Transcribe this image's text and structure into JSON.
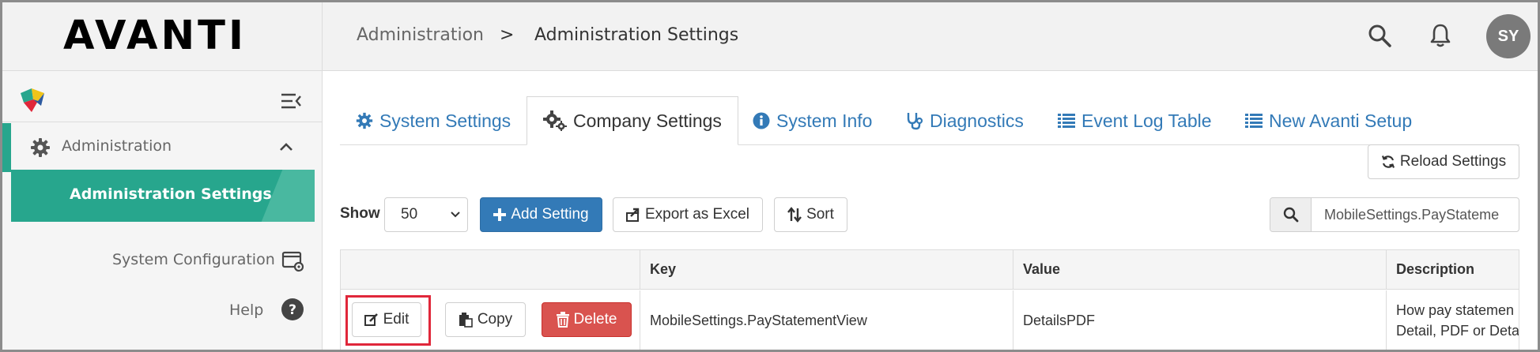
{
  "app": {
    "logo": "AVANTI"
  },
  "breadcrumb": {
    "parent": "Administration",
    "separator": ">",
    "current": "Administration Settings"
  },
  "header": {
    "avatar_initials": "SY",
    "icons": [
      "search-icon",
      "bell-icon"
    ]
  },
  "sidebar": {
    "section": {
      "label": "Administration",
      "icon": "gear-icon",
      "expanded": true
    },
    "active_item": "Administration Settings",
    "items": [
      {
        "label": "System Configuration",
        "icon": "settings-window-icon"
      },
      {
        "label": "Help",
        "icon": "question-circle-icon"
      }
    ]
  },
  "tabs": [
    {
      "label": "System Settings",
      "icon": "gear-icon",
      "active": false
    },
    {
      "label": "Company Settings",
      "icon": "gears-icon",
      "active": true
    },
    {
      "label": "System Info",
      "icon": "info-circle-icon",
      "active": false
    },
    {
      "label": "Diagnostics",
      "icon": "stethoscope-icon",
      "active": false
    },
    {
      "label": "Event Log Table",
      "icon": "list-icon",
      "active": false
    },
    {
      "label": "New Avanti Setup",
      "icon": "list-icon",
      "active": false
    }
  ],
  "toolbar": {
    "reload_label": "Reload Settings",
    "show_label": "Show",
    "page_size": "50",
    "add_label": "Add Setting",
    "export_label": "Export as Excel",
    "sort_label": "Sort",
    "search_value": "MobileSettings.PayStateme"
  },
  "table": {
    "columns": [
      "",
      "Key",
      "Value",
      "Description"
    ],
    "rows": [
      {
        "actions": {
          "edit": "Edit",
          "copy": "Copy",
          "delete": "Delete"
        },
        "key": "MobileSettings.PayStatementView",
        "value": "DetailsPDF",
        "description_line1": "How pay statemen",
        "description_line2": "Detail, PDF or Deta"
      }
    ]
  },
  "colors": {
    "brand_teal": "#27a68d",
    "link_blue": "#337ab7",
    "danger_red": "#d9534f",
    "highlight": "#e0273a"
  }
}
